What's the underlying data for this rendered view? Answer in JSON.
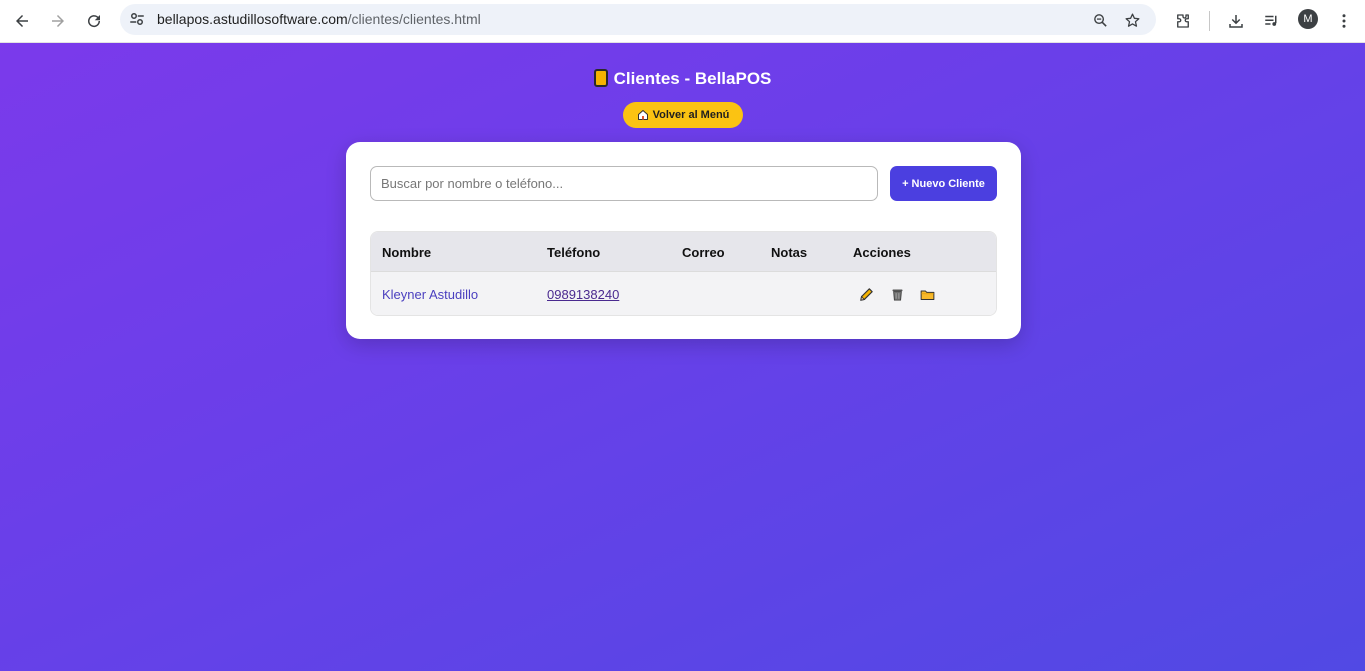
{
  "browser": {
    "url_host": "bellapos.astudillosoftware.com",
    "url_path": "/clientes/clientes.html",
    "avatar_letter": "M"
  },
  "page": {
    "title": "Clientes - BellaPOS",
    "back_button": "Volver al Menú",
    "search_placeholder": "Buscar por nombre o teléfono...",
    "new_button": "+ Nuevo Cliente"
  },
  "table": {
    "headers": [
      "Nombre",
      "Teléfono",
      "Correo",
      "Notas",
      "Acciones"
    ],
    "rows": [
      {
        "nombre": "Kleyner Astudillo",
        "telefono": "0989138240",
        "correo": "",
        "notas": ""
      }
    ]
  },
  "colors": {
    "background_start": "#7b3aeb",
    "background_end": "#5149e4",
    "back_button": "#fbc312",
    "primary_button": "#4b3fe0"
  },
  "icons": [
    "back-arrow-icon",
    "forward-arrow-icon",
    "reload-icon",
    "site-settings-icon",
    "zoom-icon",
    "star-icon",
    "extensions-icon",
    "download-icon",
    "media-icon",
    "more-icon",
    "ledger-icon",
    "home-icon",
    "pencil-icon",
    "trash-icon",
    "folder-icon"
  ]
}
